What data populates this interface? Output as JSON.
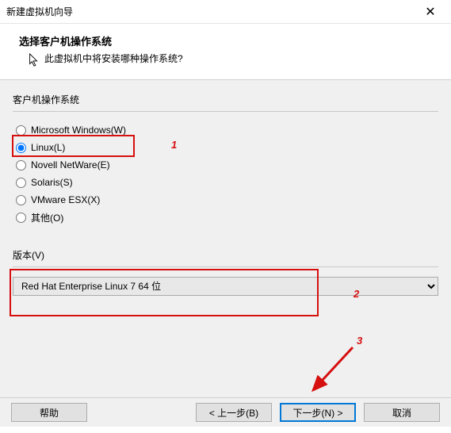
{
  "window": {
    "title": "新建虚拟机向导",
    "close_glyph": "✕"
  },
  "header": {
    "heading": "选择客户机操作系统",
    "subheading": "此虚拟机中将安装哪种操作系统?"
  },
  "os_group": {
    "label": "客户机操作系统",
    "options": [
      {
        "label": "Microsoft Windows(W)"
      },
      {
        "label": "Linux(L)"
      },
      {
        "label": "Novell NetWare(E)"
      },
      {
        "label": "Solaris(S)"
      },
      {
        "label": "VMware ESX(X)"
      },
      {
        "label": "其他(O)"
      }
    ]
  },
  "version": {
    "label": "版本(V)",
    "selected": "Red Hat Enterprise Linux 7 64 位"
  },
  "footer": {
    "help": "帮助",
    "back": "< 上一步(B)",
    "next": "下一步(N) >",
    "cancel": "取消"
  },
  "annotations": {
    "n1": "1",
    "n2": "2",
    "n3": "3"
  }
}
